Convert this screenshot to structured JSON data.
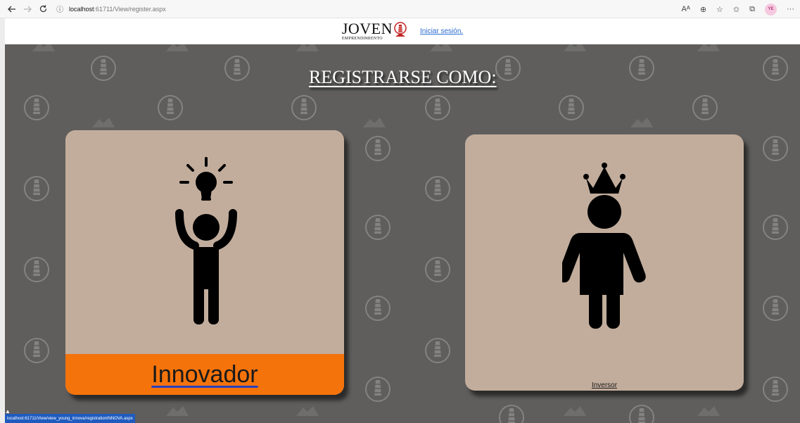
{
  "browser": {
    "back_icon": "arrow-left-icon",
    "forward_icon": "arrow-right-icon",
    "refresh_icon": "refresh-icon",
    "info_icon": "info-icon",
    "url_host": "localhost",
    "url_rest": ":61711/View/register.aspx",
    "profile_initials": "YE"
  },
  "header": {
    "logo_main": "JOVEN",
    "logo_sub": "EMPRENDIMIENTO",
    "login_link": "Iniciar sesión."
  },
  "page": {
    "title": "REGISTRARSE COMO:",
    "background_color": "#5f5e5d"
  },
  "cards": {
    "innovador": {
      "label": "Innovador",
      "label_bg": "#f5730b",
      "card_bg": "#c2ad9c"
    },
    "inversor": {
      "label": "Inversor",
      "card_bg": "#c2ad9c"
    }
  },
  "status": {
    "hover_url": "localhost:61711/View/view_young_innova/registrationINNOVA.aspx"
  }
}
